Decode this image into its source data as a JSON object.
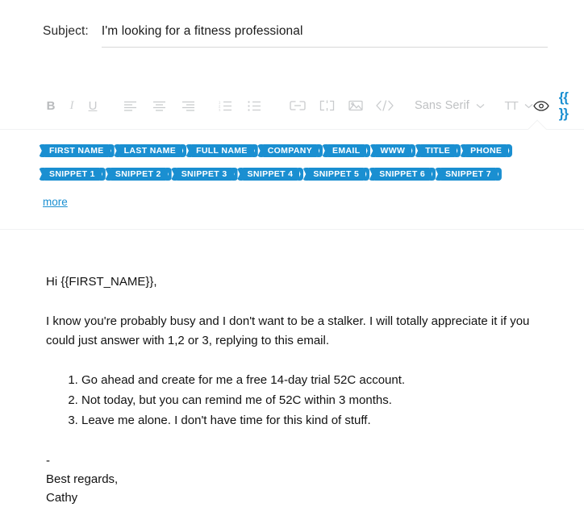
{
  "subject": {
    "label": "Subject:",
    "value": "I'm looking for a fitness professional",
    "placeholder": "Subject"
  },
  "toolbar": {
    "bold_label": "B",
    "italic_label": "I",
    "underline_label": "U",
    "font_family_value": "Sans Serif",
    "font_size_label": "TT",
    "icons": {
      "align_left": "align-left-icon",
      "align_center": "align-center-icon",
      "align_right": "align-right-icon",
      "ordered_list": "ordered-list-icon",
      "bullet_list": "bullet-list-icon",
      "link": "link-icon",
      "crop": "crop-icon",
      "image": "image-icon",
      "code": "code-icon",
      "preview": "eye-icon",
      "merge_tags": "curly-braces-icon"
    },
    "merge_tags_label": "{{ }}",
    "colors": {
      "accent": "#1a8fd1",
      "icon_muted": "#c9cbcd",
      "divider": "#f1f2f3"
    }
  },
  "tags_panel": {
    "rows": [
      [
        {
          "label": "FIRST NAME"
        },
        {
          "label": "LAST NAME"
        },
        {
          "label": "FULL NAME"
        },
        {
          "label": "COMPANY"
        },
        {
          "label": "EMAIL"
        },
        {
          "label": "WWW"
        },
        {
          "label": "TITLE"
        },
        {
          "label": "PHONE"
        }
      ],
      [
        {
          "label": "SNIPPET 1"
        },
        {
          "label": "SNIPPET 2"
        },
        {
          "label": "SNIPPET 3"
        },
        {
          "label": "SNIPPET 4"
        },
        {
          "label": "SNIPPET 5"
        },
        {
          "label": "SNIPPET 6"
        },
        {
          "label": "SNIPPET 7"
        }
      ]
    ],
    "more_label": "more"
  },
  "message": {
    "greeting": "Hi {{FIRST_NAME}},",
    "paragraph": "I know you're probably busy and I don't want to be a stalker. I will totally appreciate it if you could just answer with 1,2 or 3, replying to this email.",
    "options": [
      "Go ahead and create for me a free 14-day trial 52C account.",
      "Not today, but you can remind me of 52C within 3 months.",
      "Leave me alone. I don't have time for this kind of stuff."
    ],
    "signature_dash": "-",
    "signature_closing": "Best regards,",
    "signature_name": "Cathy"
  }
}
